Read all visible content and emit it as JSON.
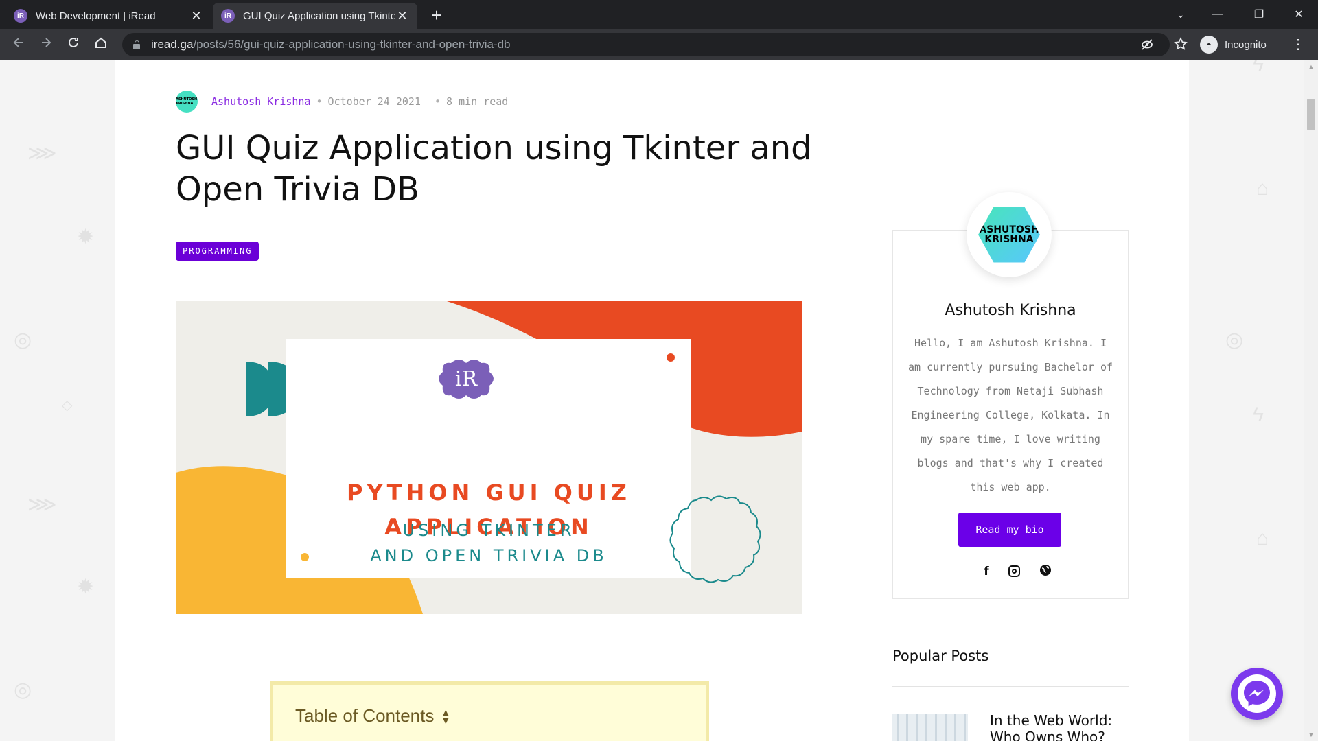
{
  "browser": {
    "tabs": [
      {
        "title": "Web Development | iRead",
        "active": false
      },
      {
        "title": "GUI Quiz Application using Tkinter and Open Trivia DB",
        "active": true
      }
    ],
    "url_host": "iread.ga",
    "url_path": "/posts/56/gui-quiz-application-using-tkinter-and-open-trivia-db",
    "profile_label": "Incognito",
    "icons": {
      "back": "arrow-left-icon",
      "forward": "arrow-right-icon",
      "reload": "reload-icon",
      "home": "home-icon",
      "tracking": "eye-off-icon",
      "bookmark": "star-icon",
      "menu": "kebab-icon"
    }
  },
  "post": {
    "author": "Ashutosh Krishna",
    "date": "October 24 2021",
    "read_time": "8 min read",
    "title": "GUI Quiz Application using Tkinter and Open Trivia DB",
    "category": "PROGRAMMING",
    "hero": {
      "logo_text": "iR",
      "line1": "PYTHON GUI QUIZ",
      "line2": "APPLICATION",
      "line3": "USING TKINTER",
      "line4": "AND OPEN TRIVIA DB"
    },
    "toc_title": "Table of Contents"
  },
  "sidebar": {
    "avatar_text": "ASHUTOSH\nKRISHNA",
    "mini_avatar_text": "ASHUTOSH KRISHNA",
    "name": "Ashutosh Krishna",
    "bio": "Hello, I am Ashutosh Krishna. I am currently pursuing Bachelor of Technology from Netaji Subhash Engineering College, Kolkata. In my spare time, I love writing blogs and that's why I created this web app.",
    "bio_button": "Read my bio",
    "social_icons": [
      "facebook-icon",
      "instagram-icon",
      "globe-icon"
    ],
    "popular_title": "Popular Posts",
    "popular_posts": [
      {
        "title": "In the Web World: Who Owns Who?"
      }
    ]
  },
  "colors": {
    "accent": "#6b00e8",
    "author_link": "#8a2be2",
    "hero_orange": "#e84a22",
    "hero_teal": "#1b8a8c",
    "hero_yellow": "#f9b634"
  }
}
